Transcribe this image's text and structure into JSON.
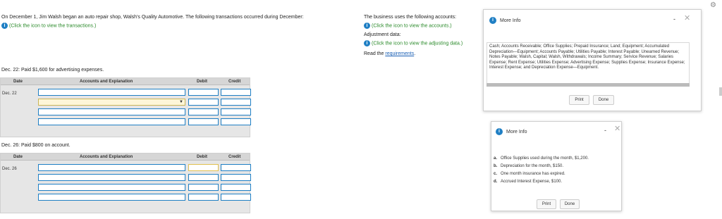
{
  "problem": {
    "intro": "On December 1, Jim Walsh began an auto repair shop, Walsh's Quality Automotive. The following transactions occurred during December:",
    "transactions_link": "(Click the icon to view the transactions.)",
    "accounts_intro": "The business uses the following accounts:",
    "accounts_link": "(Click the icon to view the accounts.)",
    "adjustment_label": "Adjustment data:",
    "adjusting_link": "(Click the icon to view the adjusting data.)",
    "read_prefix": "Read the ",
    "requirements_link": "requirements",
    "read_suffix": "."
  },
  "entries": [
    {
      "prompt": "Dec. 22: Paid $1,600 for advertising expenses.",
      "headers": {
        "date": "Date",
        "accounts": "Accounts and Explanation",
        "debit": "Debit",
        "credit": "Credit"
      },
      "date_value": "Dec. 22"
    },
    {
      "prompt": "Dec. 26: Paid $800 on account.",
      "headers": {
        "date": "Date",
        "accounts": "Accounts and Explanation",
        "debit": "Debit",
        "credit": "Credit"
      },
      "date_value": "Dec. 26"
    }
  ],
  "popup_accounts": {
    "title": "More Info",
    "minimize": "-",
    "close": "✕",
    "text": "Cash; Accounts Receivable; Office Supplies; Prepaid Insurance; Land; Equipment; Accumulated Depreciation—Equipment; Accounts Payable; Utilities Payable; Interest Payable; Unearned Revenue; Notes Payable; Walsh, Capital; Walsh, Withdrawals; Income Summary; Service Revenue; Salaries Expense; Rent Expense; Utilities Expense; Advertising Expense; Supplies Expense; Insurance Expense; Interest Expense; and Depreciation Expense—Equipment.",
    "print": "Print",
    "done": "Done"
  },
  "popup_adjustments": {
    "title": "More Info",
    "minimize": "-",
    "close": "✕",
    "items": [
      {
        "letter": "a.",
        "text": "Office Supplies used during the month, $1,200."
      },
      {
        "letter": "b.",
        "text": "Depreciation for the month, $150."
      },
      {
        "letter": "c.",
        "text": "One month insurance has expired."
      },
      {
        "letter": "d.",
        "text": "Accrued Interest Expense, $100."
      }
    ],
    "print": "Print",
    "done": "Done"
  },
  "icons": {
    "info": "info-icon",
    "gear": "gear-icon",
    "dropdown": "dropdown-arrow-icon"
  },
  "colors": {
    "accent": "#1f7fc4",
    "link_green": "#2a8a2a",
    "header_gray": "#d6d6d6"
  }
}
